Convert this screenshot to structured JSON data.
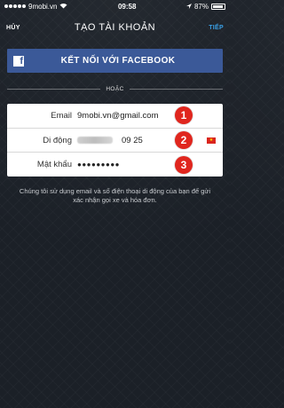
{
  "status_bar": {
    "carrier": "9mobi.vn",
    "time": "09:58",
    "battery_percent": "87%"
  },
  "nav": {
    "cancel_label": "HỦY",
    "title": "TẠO TÀI KHOẢN",
    "next_label": "TIẾP"
  },
  "facebook": {
    "button_label": "KẾT NỐI VỚI FACEBOOK",
    "icon_letter": "f"
  },
  "divider_text": "HOẶC",
  "form": {
    "rows": [
      {
        "label": "Email",
        "value": "9mobi.vn@gmail.com",
        "badge": "1"
      },
      {
        "label": "Di động",
        "value": "09 25",
        "badge": "2"
      },
      {
        "label": "Mật khẩu",
        "value": "●●●●●●●●●",
        "badge": "3"
      }
    ],
    "flag_symbol": "★"
  },
  "info_text": "Chúng tôi sử dụng email và số điện thoại di động của bạn để gửi xác nhận gọi xe và hóa đơn.",
  "colors": {
    "facebook_blue": "#3b5998",
    "next_link": "#3aa0e6",
    "badge_red": "#e0261e",
    "background": "#1b2027"
  }
}
